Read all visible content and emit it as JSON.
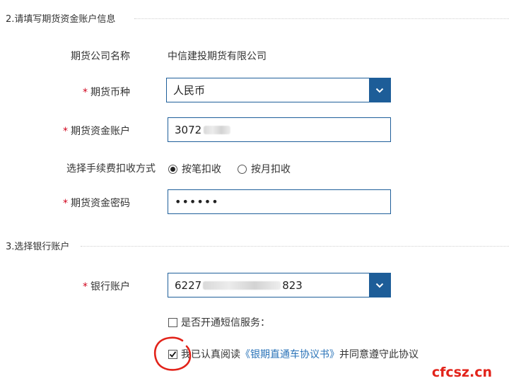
{
  "section_futures": {
    "title": "2.请填写期货资金账户信息"
  },
  "futures": {
    "company_label": "期货公司名称",
    "company_value": "中信建投期货有限公司",
    "currency_label": "期货币种",
    "currency_value": "人民币",
    "account_label": "期货资金账户",
    "account_value": "3072",
    "fee_method_label": "选择手续费扣收方式",
    "fee_options": [
      {
        "label": "按笔扣收",
        "selected": true
      },
      {
        "label": "按月扣收",
        "selected": false
      }
    ],
    "password_label": "期货资金密码",
    "password_value": "••••••",
    "required_mark": "*"
  },
  "section_bank": {
    "title": "3.选择银行账户"
  },
  "bank": {
    "account_label": "银行账户",
    "account_prefix": "6227",
    "account_suffix": "823",
    "sms_label": "是否开通短信服务：",
    "sms_checked": false,
    "agree_prefix": "我已认真阅读",
    "agree_link": "《银期直通车协议书》",
    "agree_suffix": "并同意遵守此协议",
    "agree_checked": true
  },
  "watermark": "cfcsz.cn",
  "colors": {
    "accent": "#1d5d98",
    "required": "#d0021b",
    "link": "#2a73b8",
    "annotation": "#e2231a"
  }
}
